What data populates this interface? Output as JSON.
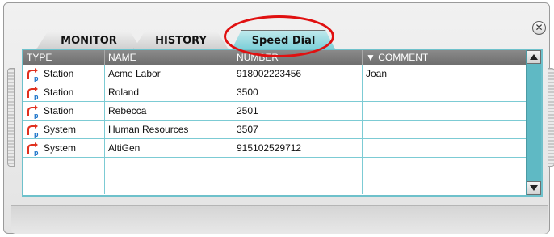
{
  "tabs": [
    {
      "label": "MONITOR",
      "active": false
    },
    {
      "label": "HISTORY",
      "active": false
    },
    {
      "label": "Speed Dial",
      "active": true
    }
  ],
  "table": {
    "columns": [
      "TYPE",
      "NAME",
      "NUMBER",
      "▼ COMMENT"
    ],
    "rows": [
      {
        "type": "Station",
        "name": "Acme Labor",
        "number": "918002223456",
        "comment": "Joan"
      },
      {
        "type": "Station",
        "name": "Roland",
        "number": "3500",
        "comment": ""
      },
      {
        "type": "Station",
        "name": "Rebecca",
        "number": "2501",
        "comment": ""
      },
      {
        "type": "System",
        "name": "Human Resources",
        "number": "3507",
        "comment": ""
      },
      {
        "type": "System",
        "name": "AltiGen",
        "number": "915102529712",
        "comment": ""
      }
    ]
  },
  "icons": {
    "close": "close-circle-icon",
    "row_type": "phone-transfer-icon",
    "scroll_up": "arrow-up-icon",
    "scroll_down": "arrow-down-icon"
  },
  "colors": {
    "accent": "#6ec1cb",
    "header": "#7a7a7a",
    "highlight": "#e01010"
  }
}
